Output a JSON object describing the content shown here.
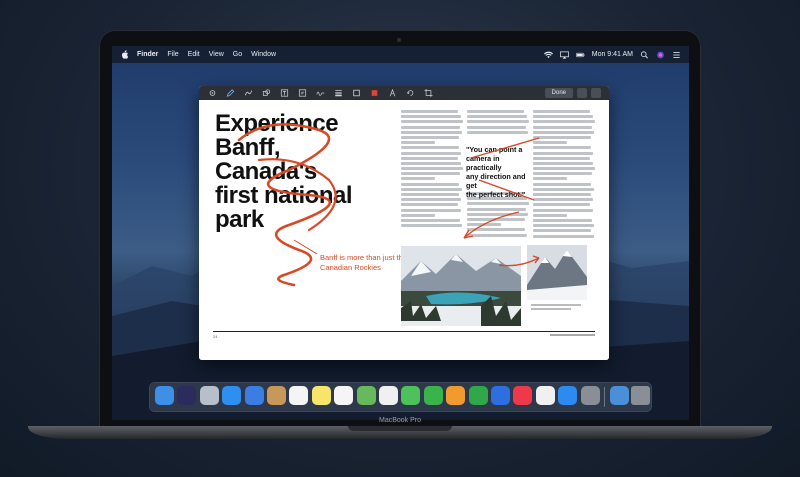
{
  "device": {
    "brand_label": "MacBook Pro"
  },
  "menubar": {
    "app_name": "Finder",
    "items": [
      "File",
      "Edit",
      "View",
      "Go",
      "Window"
    ],
    "clock": "Mon 9:41 AM"
  },
  "window": {
    "toolbar": {
      "done_label": "Done"
    },
    "document": {
      "headline_lines": [
        "Experience",
        "Banff,",
        "Canada's",
        "first national",
        "park"
      ],
      "annotation_caption_line1": "Banff is more than just the",
      "annotation_caption_line2": "Canadian Rockies",
      "pull_quote_line1": "\"You can point a",
      "pull_quote_line2": "camera in practically",
      "pull_quote_line3": "any direction and get",
      "pull_quote_line4": "the perfect shot.\"",
      "page_number": "24"
    }
  },
  "dock": {
    "apps": [
      {
        "name": "finder",
        "color": "#3d8fe8"
      },
      {
        "name": "siri",
        "color": "#2b2b5e"
      },
      {
        "name": "launchpad",
        "color": "#b7bfca"
      },
      {
        "name": "safari",
        "color": "#2f8ff0"
      },
      {
        "name": "mail",
        "color": "#3b7de0"
      },
      {
        "name": "contacts",
        "color": "#c8975a"
      },
      {
        "name": "calendar",
        "color": "#f4f4f4"
      },
      {
        "name": "notes",
        "color": "#f7e56a"
      },
      {
        "name": "reminders",
        "color": "#f5f5f5"
      },
      {
        "name": "maps",
        "color": "#67b95b"
      },
      {
        "name": "photos",
        "color": "#f0f0f0"
      },
      {
        "name": "messages",
        "color": "#4ec25a"
      },
      {
        "name": "facetime",
        "color": "#3ab34a"
      },
      {
        "name": "pages",
        "color": "#f19a2e"
      },
      {
        "name": "numbers",
        "color": "#2ea84b"
      },
      {
        "name": "keynote",
        "color": "#2d6fe0"
      },
      {
        "name": "news",
        "color": "#f0384b"
      },
      {
        "name": "music",
        "color": "#f0f0f0"
      },
      {
        "name": "app-store",
        "color": "#2d8af0"
      },
      {
        "name": "system-preferences",
        "color": "#8a8f97"
      }
    ]
  }
}
